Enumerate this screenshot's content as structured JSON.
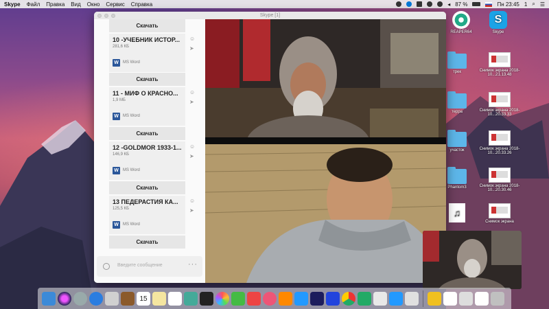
{
  "menubar": {
    "items": [
      "Skype",
      "Файл",
      "Правка",
      "Вид",
      "Окно",
      "Сервис",
      "Справка"
    ],
    "battery": "87 %",
    "clock": "Пн 23:45",
    "user_num": "1"
  },
  "window": {
    "title": "Skype [1]"
  },
  "chat": {
    "download_label": "Скачать",
    "files": [
      {
        "name": "10 -УЧЕБНИК ИСТОР...",
        "size": "281,6 КБ",
        "type": "MS Word"
      },
      {
        "name": "11 - МИФ О КРАСНО...",
        "size": "1,9 МБ",
        "type": "MS Word"
      },
      {
        "name": "12 -GOLDMOR 1933-1...",
        "size": "146,9 КБ",
        "type": "MS Word"
      },
      {
        "name": "13 ПЕДЕРАСТИЯ КА...",
        "size": "125,5 КБ",
        "type": "MS Word"
      }
    ],
    "composer_placeholder": "Введите сообщение",
    "word_icon_letter": "W"
  },
  "desktop_icons": [
    {
      "label": "REAPER64",
      "icon": "reaper-icon"
    },
    {
      "label": "Skype",
      "icon": "skype-icon"
    },
    {
      "label": "трек",
      "icon": "folder-icon"
    },
    {
      "label": "Снимок экрана 2018-10...21.13.48",
      "icon": "screenshot-icon"
    },
    {
      "label": "терра",
      "icon": "folder-icon"
    },
    {
      "label": "Снимок экрана 2018-10...20.33.33",
      "icon": "screenshot-icon"
    },
    {
      "label": "участок",
      "icon": "folder-icon"
    },
    {
      "label": "Снимок экрана 2018-10...20.33.26",
      "icon": "screenshot-icon"
    },
    {
      "label": "Phantom3",
      "icon": "folder-icon"
    },
    {
      "label": "Снимок экрана 2018-10...20.30.46",
      "icon": "screenshot-icon"
    },
    {
      "label": "Снимок экрана",
      "icon": "screenshot-icon"
    }
  ],
  "dock_colors": [
    "#3c8ad8",
    "#7a5bd6",
    "#9aa",
    "#2b7de0",
    "#d0d0d0",
    "#8b5a2b",
    "#fff",
    "#f5e6a0",
    "#fff",
    "#4a9",
    "#222",
    "#f4c",
    "#4b4",
    "#e44",
    "#e57",
    "#29f",
    "#1c1c5c",
    "#24d",
    "#2a6",
    "#2a6",
    "#e33",
    "#e8e8e8",
    "#29f",
    "#e0e0e0",
    "#f0c020",
    "#fff",
    "#ddd",
    "#fff",
    "#c0c0c0"
  ],
  "calendar_day": "15"
}
